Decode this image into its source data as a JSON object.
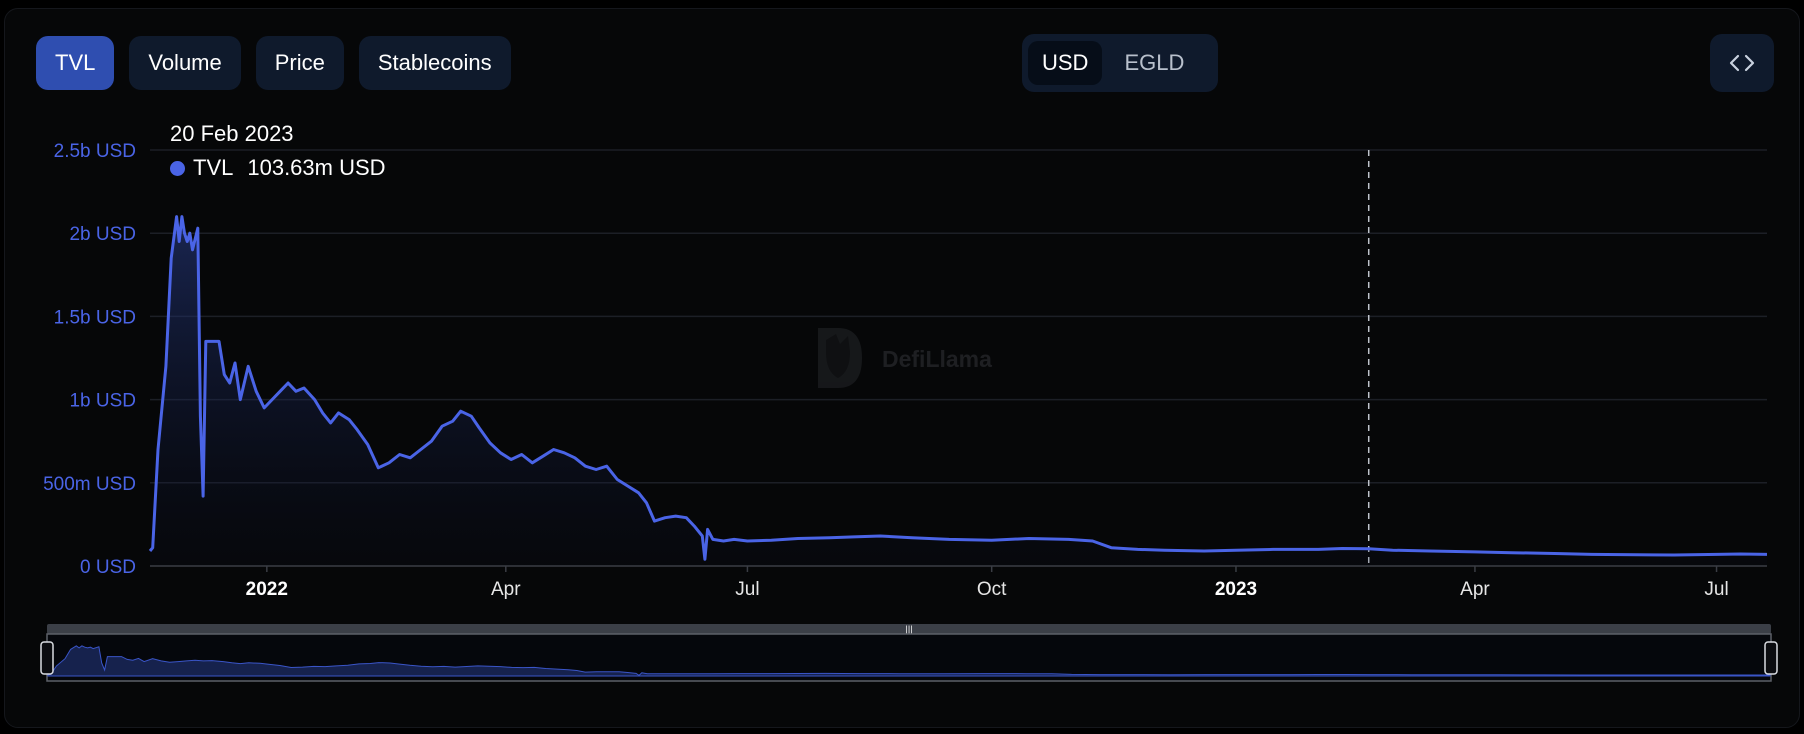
{
  "tabs": [
    {
      "label": "TVL",
      "active": true
    },
    {
      "label": "Volume",
      "active": false
    },
    {
      "label": "Price",
      "active": false
    },
    {
      "label": "Stablecoins",
      "active": false
    }
  ],
  "currency_toggle": [
    {
      "label": "USD",
      "active": true
    },
    {
      "label": "EGLD",
      "active": false
    }
  ],
  "embed_icon": "code-brackets-icon",
  "watermark": "DefiLlama",
  "tooltip": {
    "date": "20 Feb 2023",
    "series": "TVL",
    "value": "103.63m USD"
  },
  "colors": {
    "series": "#4a64e6",
    "accent": "#2f4eb0",
    "panel": "#0f1a2c"
  },
  "chart_data": {
    "type": "area",
    "grid": true,
    "x_ticks": [
      {
        "label": "2022",
        "date": "2022-01-01",
        "bold": true
      },
      {
        "label": "Apr",
        "date": "2022-04-01",
        "bold": false
      },
      {
        "label": "Jul",
        "date": "2022-07-01",
        "bold": false
      },
      {
        "label": "Oct",
        "date": "2022-10-01",
        "bold": false
      },
      {
        "label": "2023",
        "date": "2023-01-01",
        "bold": true
      },
      {
        "label": "Apr",
        "date": "2023-04-01",
        "bold": false
      },
      {
        "label": "Jul",
        "date": "2023-07-01",
        "bold": false
      }
    ],
    "y_ticks": [
      {
        "label": "0 USD",
        "value": 0
      },
      {
        "label": "500m USD",
        "value": 500
      },
      {
        "label": "1b USD",
        "value": 1000
      },
      {
        "label": "1.5b USD",
        "value": 1500
      },
      {
        "label": "2b USD",
        "value": 2000
      },
      {
        "label": "2.5b USD",
        "value": 2500
      }
    ],
    "xlim": [
      "2021-11-18",
      "2023-07-20"
    ],
    "ylim": [
      0,
      2500
    ],
    "y_unit": "million USD",
    "highlight_date": "2023-02-20",
    "series": [
      {
        "name": "TVL",
        "points": [
          [
            "2021-11-18",
            90
          ],
          [
            "2021-11-19",
            110
          ],
          [
            "2021-11-21",
            700
          ],
          [
            "2021-11-24",
            1200
          ],
          [
            "2021-11-26",
            1850
          ],
          [
            "2021-11-28",
            2100
          ],
          [
            "2021-11-29",
            1950
          ],
          [
            "2021-11-30",
            2100
          ],
          [
            "2021-12-01",
            2000
          ],
          [
            "2021-12-02",
            1950
          ],
          [
            "2021-12-03",
            2000
          ],
          [
            "2021-12-04",
            1900
          ],
          [
            "2021-12-06",
            2030
          ],
          [
            "2021-12-07",
            900
          ],
          [
            "2021-12-08",
            420
          ],
          [
            "2021-12-09",
            1350
          ],
          [
            "2021-12-11",
            1350
          ],
          [
            "2021-12-14",
            1350
          ],
          [
            "2021-12-16",
            1150
          ],
          [
            "2021-12-18",
            1100
          ],
          [
            "2021-12-20",
            1220
          ],
          [
            "2021-12-22",
            1000
          ],
          [
            "2021-12-25",
            1200
          ],
          [
            "2021-12-28",
            1050
          ],
          [
            "2021-12-31",
            950
          ],
          [
            "2022-01-03",
            1000
          ],
          [
            "2022-01-06",
            1050
          ],
          [
            "2022-01-09",
            1100
          ],
          [
            "2022-01-12",
            1050
          ],
          [
            "2022-01-15",
            1070
          ],
          [
            "2022-01-19",
            1000
          ],
          [
            "2022-01-22",
            920
          ],
          [
            "2022-01-25",
            860
          ],
          [
            "2022-01-28",
            920
          ],
          [
            "2022-02-01",
            880
          ],
          [
            "2022-02-04",
            820
          ],
          [
            "2022-02-08",
            730
          ],
          [
            "2022-02-12",
            590
          ],
          [
            "2022-02-16",
            620
          ],
          [
            "2022-02-20",
            670
          ],
          [
            "2022-02-24",
            650
          ],
          [
            "2022-02-28",
            700
          ],
          [
            "2022-03-04",
            750
          ],
          [
            "2022-03-08",
            840
          ],
          [
            "2022-03-12",
            870
          ],
          [
            "2022-03-15",
            930
          ],
          [
            "2022-03-19",
            900
          ],
          [
            "2022-03-22",
            830
          ],
          [
            "2022-03-26",
            740
          ],
          [
            "2022-03-30",
            680
          ],
          [
            "2022-04-03",
            640
          ],
          [
            "2022-04-07",
            670
          ],
          [
            "2022-04-11",
            620
          ],
          [
            "2022-04-15",
            660
          ],
          [
            "2022-04-19",
            700
          ],
          [
            "2022-04-23",
            680
          ],
          [
            "2022-04-27",
            650
          ],
          [
            "2022-05-01",
            600
          ],
          [
            "2022-05-05",
            580
          ],
          [
            "2022-05-09",
            600
          ],
          [
            "2022-05-13",
            520
          ],
          [
            "2022-05-17",
            480
          ],
          [
            "2022-05-21",
            440
          ],
          [
            "2022-05-24",
            380
          ],
          [
            "2022-05-27",
            270
          ],
          [
            "2022-05-31",
            290
          ],
          [
            "2022-06-04",
            300
          ],
          [
            "2022-06-08",
            290
          ],
          [
            "2022-06-11",
            240
          ],
          [
            "2022-06-14",
            180
          ],
          [
            "2022-06-15",
            40
          ],
          [
            "2022-06-16",
            220
          ],
          [
            "2022-06-18",
            160
          ],
          [
            "2022-06-22",
            150
          ],
          [
            "2022-06-26",
            160
          ],
          [
            "2022-07-01",
            150
          ],
          [
            "2022-07-10",
            155
          ],
          [
            "2022-07-20",
            165
          ],
          [
            "2022-08-01",
            170
          ],
          [
            "2022-08-10",
            175
          ],
          [
            "2022-08-20",
            180
          ],
          [
            "2022-09-01",
            170
          ],
          [
            "2022-09-15",
            160
          ],
          [
            "2022-10-01",
            155
          ],
          [
            "2022-10-15",
            165
          ],
          [
            "2022-10-30",
            160
          ],
          [
            "2022-11-08",
            150
          ],
          [
            "2022-11-15",
            110
          ],
          [
            "2022-11-25",
            100
          ],
          [
            "2022-12-05",
            95
          ],
          [
            "2022-12-20",
            90
          ],
          [
            "2023-01-01",
            95
          ],
          [
            "2023-01-15",
            100
          ],
          [
            "2023-02-01",
            100
          ],
          [
            "2023-02-10",
            105
          ],
          [
            "2023-02-20",
            103.63
          ],
          [
            "2023-03-01",
            95
          ],
          [
            "2023-03-15",
            90
          ],
          [
            "2023-04-01",
            85
          ],
          [
            "2023-04-15",
            80
          ],
          [
            "2023-05-01",
            75
          ],
          [
            "2023-05-15",
            70
          ],
          [
            "2023-06-01",
            68
          ],
          [
            "2023-06-15",
            66
          ],
          [
            "2023-07-01",
            70
          ],
          [
            "2023-07-10",
            72
          ],
          [
            "2023-07-20",
            70
          ]
        ]
      }
    ]
  }
}
